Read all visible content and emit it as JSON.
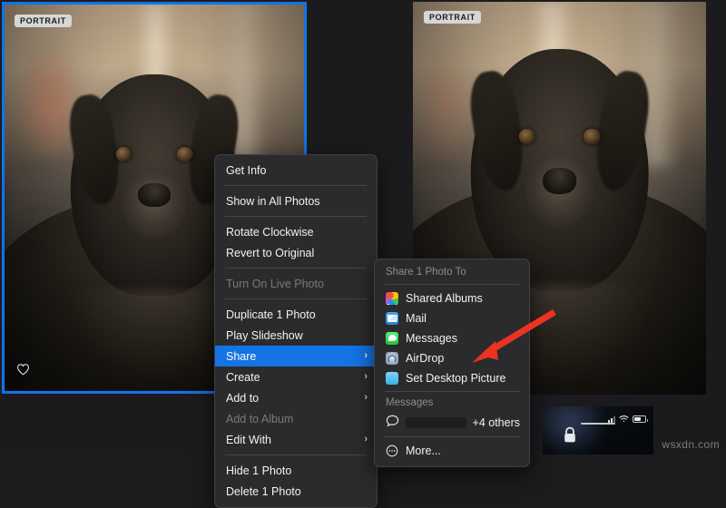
{
  "photos": [
    {
      "badge": "PORTRAIT",
      "selected": true,
      "favorite_icon": "heart-icon"
    },
    {
      "badge": "PORTRAIT",
      "selected": false,
      "favorite_icon": null
    }
  ],
  "context_menu": {
    "groups": [
      [
        {
          "label": "Get Info",
          "state": "normal",
          "submenu": false
        }
      ],
      [
        {
          "label": "Show in All Photos",
          "state": "normal",
          "submenu": false
        }
      ],
      [
        {
          "label": "Rotate Clockwise",
          "state": "normal",
          "submenu": false
        },
        {
          "label": "Revert to Original",
          "state": "normal",
          "submenu": false
        }
      ],
      [
        {
          "label": "Turn On Live Photo",
          "state": "disabled",
          "submenu": false
        }
      ],
      [
        {
          "label": "Duplicate 1 Photo",
          "state": "normal",
          "submenu": false
        },
        {
          "label": "Play Slideshow",
          "state": "normal",
          "submenu": false
        },
        {
          "label": "Share",
          "state": "highlighted",
          "submenu": true
        },
        {
          "label": "Create",
          "state": "normal",
          "submenu": true
        },
        {
          "label": "Add to",
          "state": "normal",
          "submenu": true
        },
        {
          "label": "Add to Album",
          "state": "disabled",
          "submenu": false
        },
        {
          "label": "Edit With",
          "state": "normal",
          "submenu": true
        }
      ],
      [
        {
          "label": "Hide 1 Photo",
          "state": "normal",
          "submenu": false
        },
        {
          "label": "Delete 1 Photo",
          "state": "normal",
          "submenu": false
        }
      ]
    ],
    "chevron_glyph": "›"
  },
  "share_submenu": {
    "title": "Share 1 Photo To",
    "targets": [
      {
        "label": "Shared Albums",
        "icon": "photos-icon"
      },
      {
        "label": "Mail",
        "icon": "mail-icon"
      },
      {
        "label": "Messages",
        "icon": "messages-icon"
      },
      {
        "label": "AirDrop",
        "icon": "airdrop-icon"
      },
      {
        "label": "Set Desktop Picture",
        "icon": "desktop-picture-icon"
      }
    ],
    "messages_section": {
      "header": "Messages",
      "contact_redacted": true,
      "others_label": "+4 others"
    },
    "more_label": "More...",
    "more_icon": "ellipsis-circle-icon"
  },
  "annotation": {
    "type": "arrow",
    "color": "#ec3323",
    "points_to": "Set Desktop Picture"
  },
  "phone_preview": {
    "status_icons": [
      "cellular-signal-icon",
      "wifi-icon",
      "battery-icon"
    ],
    "lock_icon": "lock-icon"
  },
  "watermark": "wsxdn.com",
  "colors": {
    "selection_border": "#1273e6",
    "menu_background": "#2b2b2d",
    "menu_highlight": "#1474e4",
    "annotation_red": "#ec3323"
  }
}
